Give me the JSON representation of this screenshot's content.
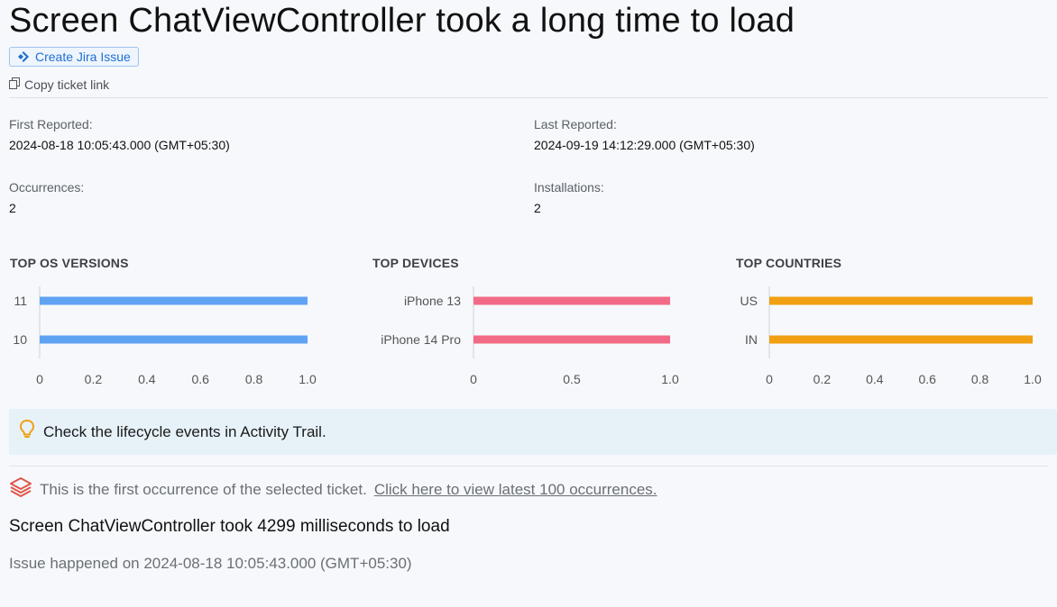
{
  "header": {
    "title": "Screen ChatViewController took a long time to load",
    "jira_button_label": "Create Jira Issue",
    "copy_link_label": "Copy ticket link"
  },
  "meta": {
    "first_reported_label": "First Reported:",
    "first_reported_value": "2024-08-18 10:05:43.000 (GMT+05:30)",
    "last_reported_label": "Last Reported:",
    "last_reported_value": "2024-09-19 14:12:29.000 (GMT+05:30)",
    "occurrences_label": "Occurrences:",
    "occurrences_value": "2",
    "installations_label": "Installations:",
    "installations_value": "2"
  },
  "chart_data": [
    {
      "type": "bar",
      "orientation": "horizontal",
      "title": "TOP OS VERSIONS",
      "categories": [
        "11",
        "10"
      ],
      "values": [
        1.0,
        1.0
      ],
      "xlim": [
        0,
        1.0
      ],
      "xticks": [
        "0",
        "0.2",
        "0.4",
        "0.6",
        "0.8",
        "1.0"
      ],
      "color": "#5fa3f2"
    },
    {
      "type": "bar",
      "orientation": "horizontal",
      "title": "TOP DEVICES",
      "categories": [
        "iPhone 13",
        "iPhone 14 Pro"
      ],
      "values": [
        1.0,
        1.0
      ],
      "xlim": [
        0,
        1.0
      ],
      "xticks": [
        "0",
        "0.5",
        "1.0"
      ],
      "color": "#f26b86"
    },
    {
      "type": "bar",
      "orientation": "horizontal",
      "title": "TOP COUNTRIES",
      "categories": [
        "US",
        "IN"
      ],
      "values": [
        1.0,
        1.0
      ],
      "xlim": [
        0,
        1.0
      ],
      "xticks": [
        "0",
        "0.2",
        "0.4",
        "0.6",
        "0.8",
        "1.0"
      ],
      "color": "#f0a012"
    }
  ],
  "tip": {
    "icon": "lightbulb-icon",
    "text": "Check the lifecycle events in Activity Trail."
  },
  "occurrence_notice": {
    "icon": "layers-icon",
    "text": "This is the first occurrence of the selected ticket.",
    "link_text": "Click here to view latest 100 occurrences."
  },
  "details": {
    "message": "Screen ChatViewController took 4299 milliseconds to load",
    "happened": "Issue happened on 2024-08-18 10:05:43.000 (GMT+05:30)"
  },
  "colors": {
    "accent_blue": "#1f6fd1",
    "tip_background": "#e6f2f8",
    "bulb": "#f0a012",
    "layers": "#e0564a"
  }
}
